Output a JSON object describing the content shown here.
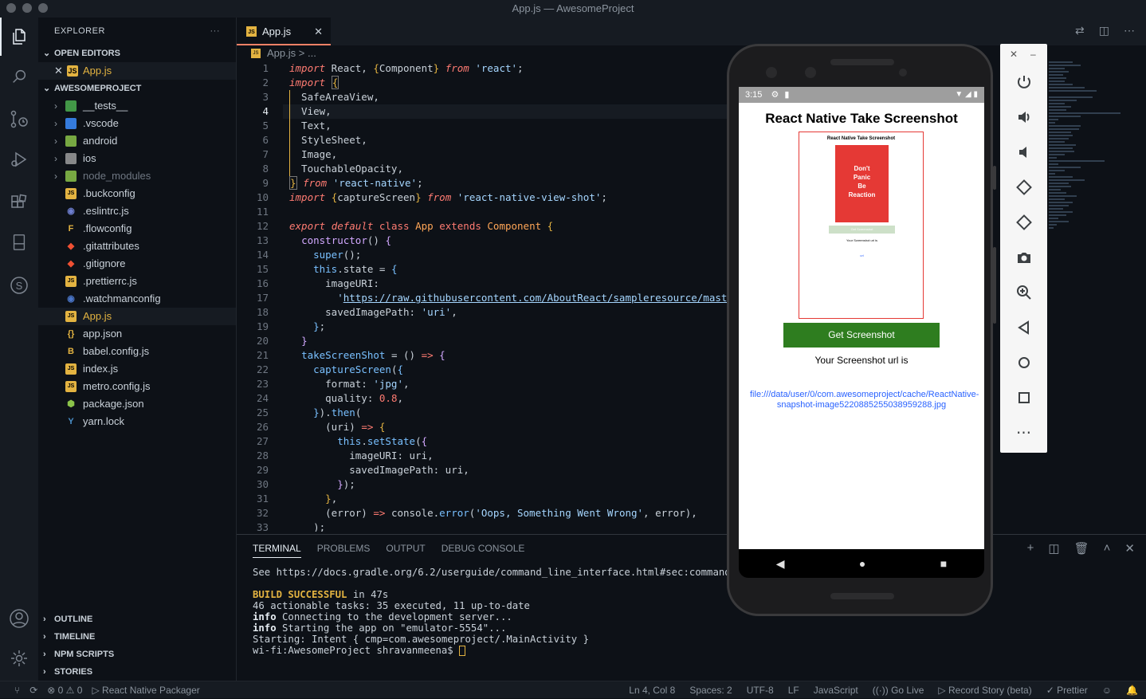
{
  "window": {
    "title": "App.js — AwesomeProject"
  },
  "activity_bar": {
    "items": [
      "explorer-icon",
      "search-icon",
      "source-control-icon",
      "run-debug-icon",
      "extensions-icon",
      "device-icon",
      "s-icon"
    ],
    "bottom": [
      "account-icon",
      "gear-icon"
    ]
  },
  "explorer": {
    "header": "EXPLORER",
    "more": "···",
    "open_editors": {
      "label": "OPEN EDITORS",
      "files": [
        {
          "close": "✕",
          "icon": "JS",
          "name": "App.js"
        }
      ]
    },
    "project": {
      "label": "AWESOMEPROJECT",
      "folders": [
        {
          "name": "__tests__",
          "color": "#4caf50"
        },
        {
          "name": ".vscode",
          "color": "#3d8eff"
        },
        {
          "name": "android",
          "color": "#8bc34a"
        },
        {
          "name": "ios",
          "color": "#9e9e9e"
        },
        {
          "name": "node_modules",
          "color": "#8bc34a"
        }
      ],
      "files": [
        {
          "name": ".buckconfig",
          "icon": "JS",
          "color": "#e3b341"
        },
        {
          "name": ".eslintrc.js",
          "icon": "◉",
          "color": "#6e7fd0"
        },
        {
          "name": ".flowconfig",
          "icon": "F",
          "color": "#e3b341"
        },
        {
          "name": ".gitattributes",
          "icon": "◆",
          "color": "#f05033"
        },
        {
          "name": ".gitignore",
          "icon": "◆",
          "color": "#f05033"
        },
        {
          "name": ".prettierrc.js",
          "icon": "JS",
          "color": "#e3b341"
        },
        {
          "name": ".watchmanconfig",
          "icon": "◉",
          "color": "#4a76c9"
        },
        {
          "name": "App.js",
          "icon": "JS",
          "color": "#e3b341"
        },
        {
          "name": "app.json",
          "icon": "{}",
          "color": "#e3b341"
        },
        {
          "name": "babel.config.js",
          "icon": "B",
          "color": "#e3b341"
        },
        {
          "name": "index.js",
          "icon": "JS",
          "color": "#e3b341"
        },
        {
          "name": "metro.config.js",
          "icon": "JS",
          "color": "#e3b341"
        },
        {
          "name": "package.json",
          "icon": "⬢",
          "color": "#8bc34a"
        },
        {
          "name": "yarn.lock",
          "icon": "Y",
          "color": "#4a90c9"
        }
      ]
    },
    "bottom_sections": [
      "OUTLINE",
      "TIMELINE",
      "NPM SCRIPTS",
      "STORIES"
    ]
  },
  "editor": {
    "tab": {
      "icon": "JS",
      "label": "App.js",
      "close": "✕"
    },
    "breadcrumb": {
      "icon": "JS",
      "file": "App.js",
      "sep": ">",
      "rest": "..."
    },
    "current_line": "4"
  },
  "panel": {
    "tabs": [
      "TERMINAL",
      "PROBLEMS",
      "OUTPUT",
      "DEBUG CONSOLE"
    ],
    "terminal": {
      "l1": "See https://docs.gradle.org/6.2/userguide/command_line_interface.html#sec:command_line",
      "l2a": "BUILD SUCCESSFUL",
      "l2b": " in 47s",
      "l3": "46 actionable tasks: 35 executed, 11 up-to-date",
      "l4a": "info",
      "l4b": " Connecting to the development server...",
      "l5a": "info",
      "l5b": " Starting the app on \"emulator-5554\"...",
      "l6": "Starting: Intent { cmp=com.awesomeproject/.MainActivity }",
      "l7": "wi-fi:AwesomeProject shravanmeena$ "
    }
  },
  "status_bar": {
    "errors": "0",
    "warnings": "0",
    "packager": "React Native Packager",
    "position": "Ln 4, Col 8",
    "spaces": "Spaces: 2",
    "encoding": "UTF-8",
    "eol": "LF",
    "language": "JavaScript",
    "golive": "Go Live",
    "record": "Record Story (beta)",
    "prettier": "Prettier"
  },
  "phone": {
    "time": "3:15",
    "app_title": "React Native Take Screenshot",
    "preview": {
      "title": "React Native Take Screenshot",
      "book": [
        "Don't",
        "Panic",
        "Be",
        "Reaction"
      ],
      "button": "Get Screenshot",
      "url_label": "Your Screenshot url is",
      "link": "uri"
    },
    "button": "Get Screenshot",
    "url_label": "Your Screenshot url is",
    "link": "file:///data/user/0/com.awesomeproject/cache/ReactNative-snapshot-image5220885255038959288.jpg"
  }
}
